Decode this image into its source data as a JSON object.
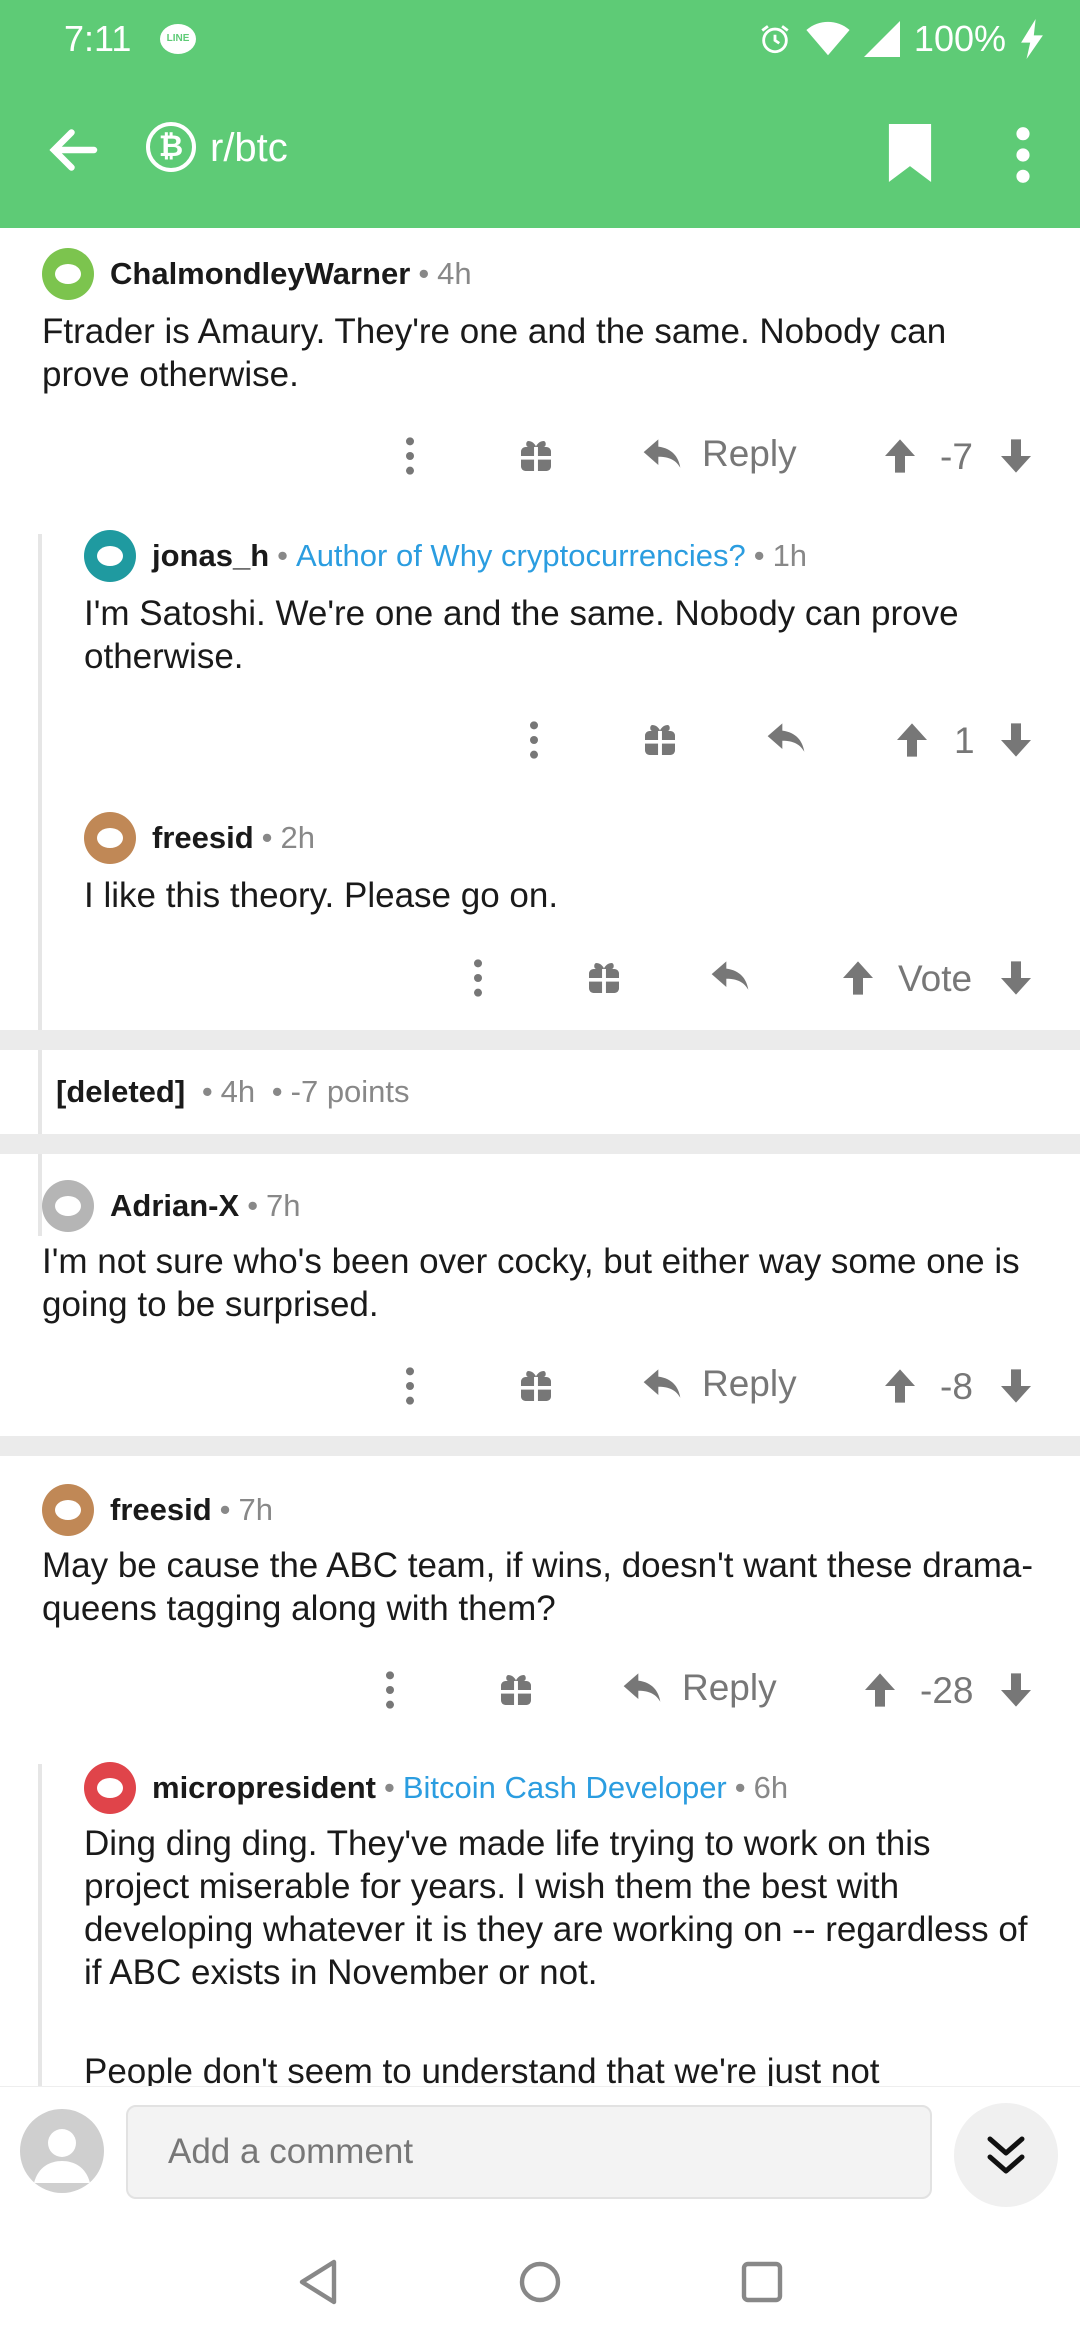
{
  "status": {
    "time": "7:11",
    "battery": "100%"
  },
  "appbar": {
    "subreddit": "r/btc",
    "logo_glyph": "₿"
  },
  "colors": {
    "brand": "#5ecb76",
    "flair": "#2b9de0",
    "icon": "#777777"
  },
  "comments": [
    {
      "user": "ChalmondleyWarner",
      "time": "4h",
      "text": "Ftrader is Amaury. They're one and the same. Nobody can prove otherwise.",
      "reply": "Reply",
      "score": "-7"
    },
    {
      "user": "jonas_h",
      "flair": "Author of Why cryptocurrencies?",
      "time": "1h",
      "text": "I'm Satoshi. We're one and the same. Nobody can prove otherwise.",
      "score": "1"
    },
    {
      "user": "freesid",
      "time": "2h",
      "text": "I like this theory. Please go on.",
      "score": "Vote"
    },
    {
      "user": "Adrian-X",
      "time": "7h",
      "text": "I'm not sure who's been over cocky, but either way some one is going to be surprised.",
      "reply": "Reply",
      "score": "-8"
    },
    {
      "user": "freesid",
      "time": "7h",
      "text": "May be cause the ABC team, if wins, doesn't want these drama-queens tagging along with them?",
      "reply": "Reply",
      "score": "-28"
    },
    {
      "user": "micropresident",
      "flair": "Bitcoin Cash Developer",
      "time": "6h",
      "text": "Ding ding ding. They've made life trying to work on this project miserable for years. I wish them the best with developing whatever it is they are working on -- regardless of if ABC exists in November or not.",
      "text2": "People don't seem to understand that we're just not"
    }
  ],
  "deleted": {
    "label": "[deleted]",
    "time": "4h",
    "points": "-7 points"
  },
  "composer": {
    "placeholder": "Add a comment"
  }
}
